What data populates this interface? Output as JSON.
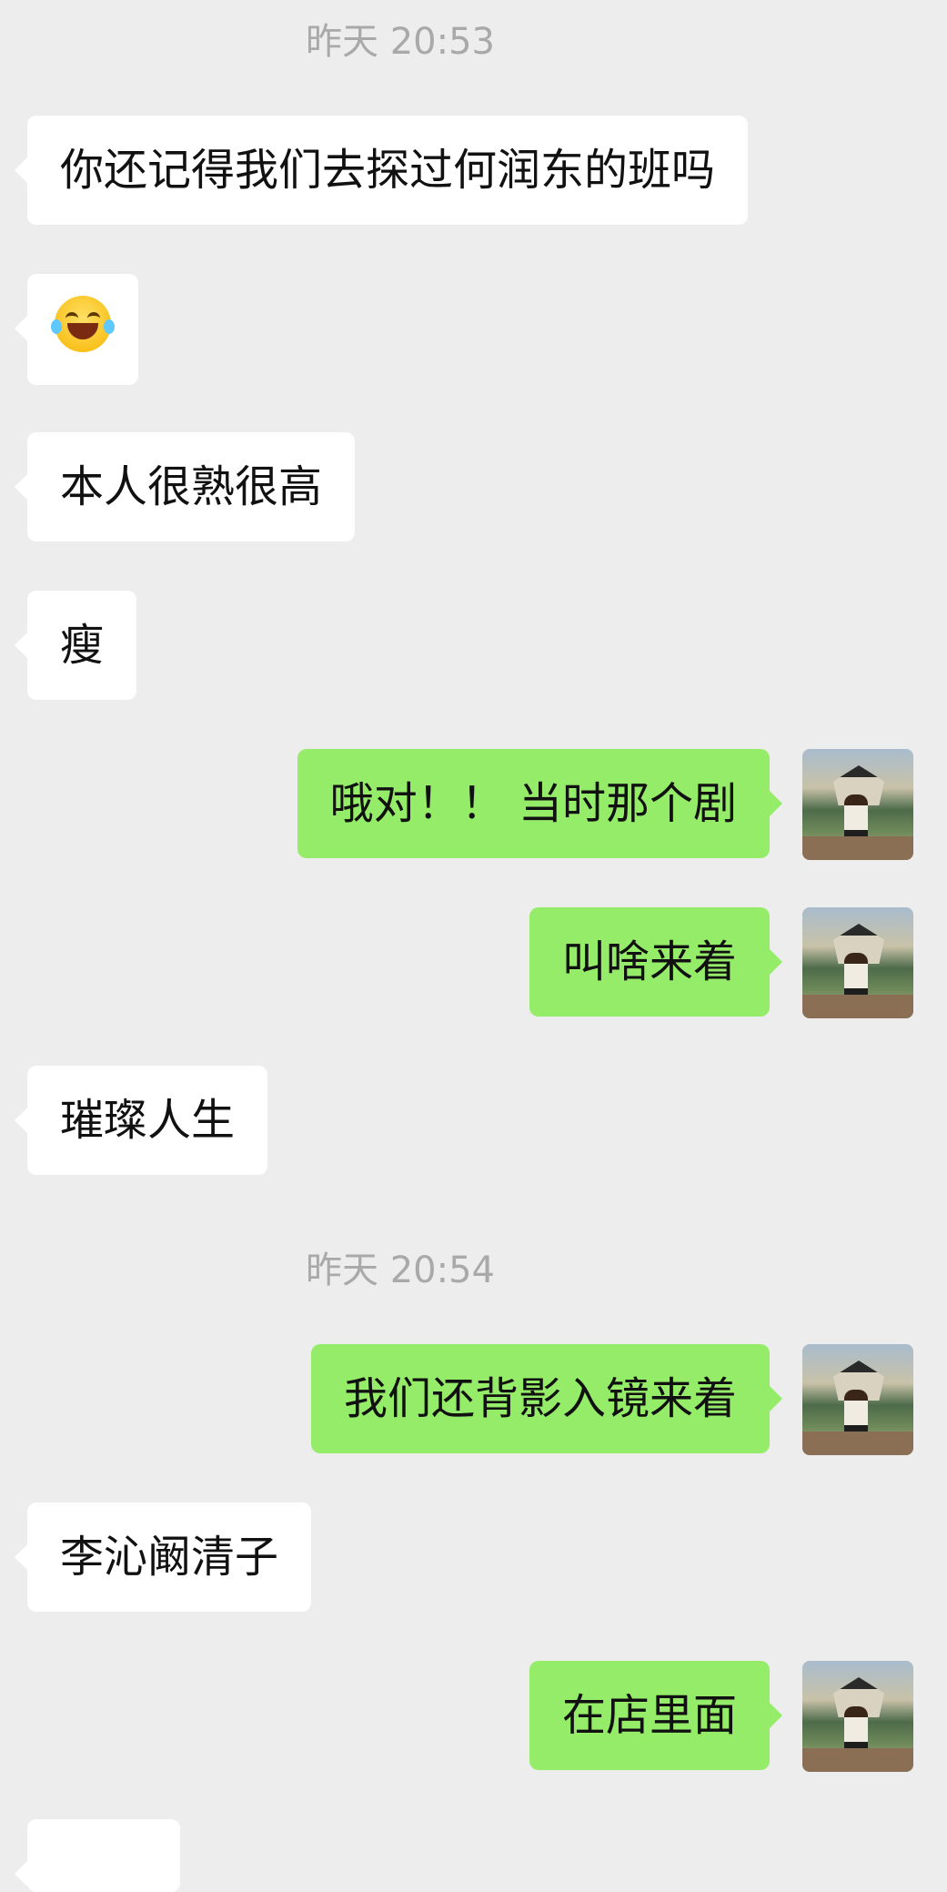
{
  "timestamps": {
    "first": "昨天 20:53",
    "second": "昨天 20:54"
  },
  "messages": [
    {
      "side": "in",
      "text": "你还记得我们去探过何润东的班吗"
    },
    {
      "side": "in",
      "emoji": "tears-of-joy-emoji"
    },
    {
      "side": "in",
      "text": "本人很熟很高"
    },
    {
      "side": "in",
      "text": "瘦"
    },
    {
      "side": "out",
      "text": "哦对！！ 当时那个剧"
    },
    {
      "side": "out",
      "text": "叫啥来着"
    },
    {
      "side": "in",
      "text": "璀璨人生"
    },
    {
      "side": "out",
      "text": "我们还背影入镜来着"
    },
    {
      "side": "in",
      "text": "李沁阚清子"
    },
    {
      "side": "out",
      "text": "在店里面"
    }
  ],
  "colors": {
    "background": "#ededed",
    "incoming_bubble": "#ffffff",
    "outgoing_bubble": "#95ec69",
    "timestamp": "#a9a9a9"
  },
  "icons": {
    "avatar": "user-avatar-photo"
  }
}
